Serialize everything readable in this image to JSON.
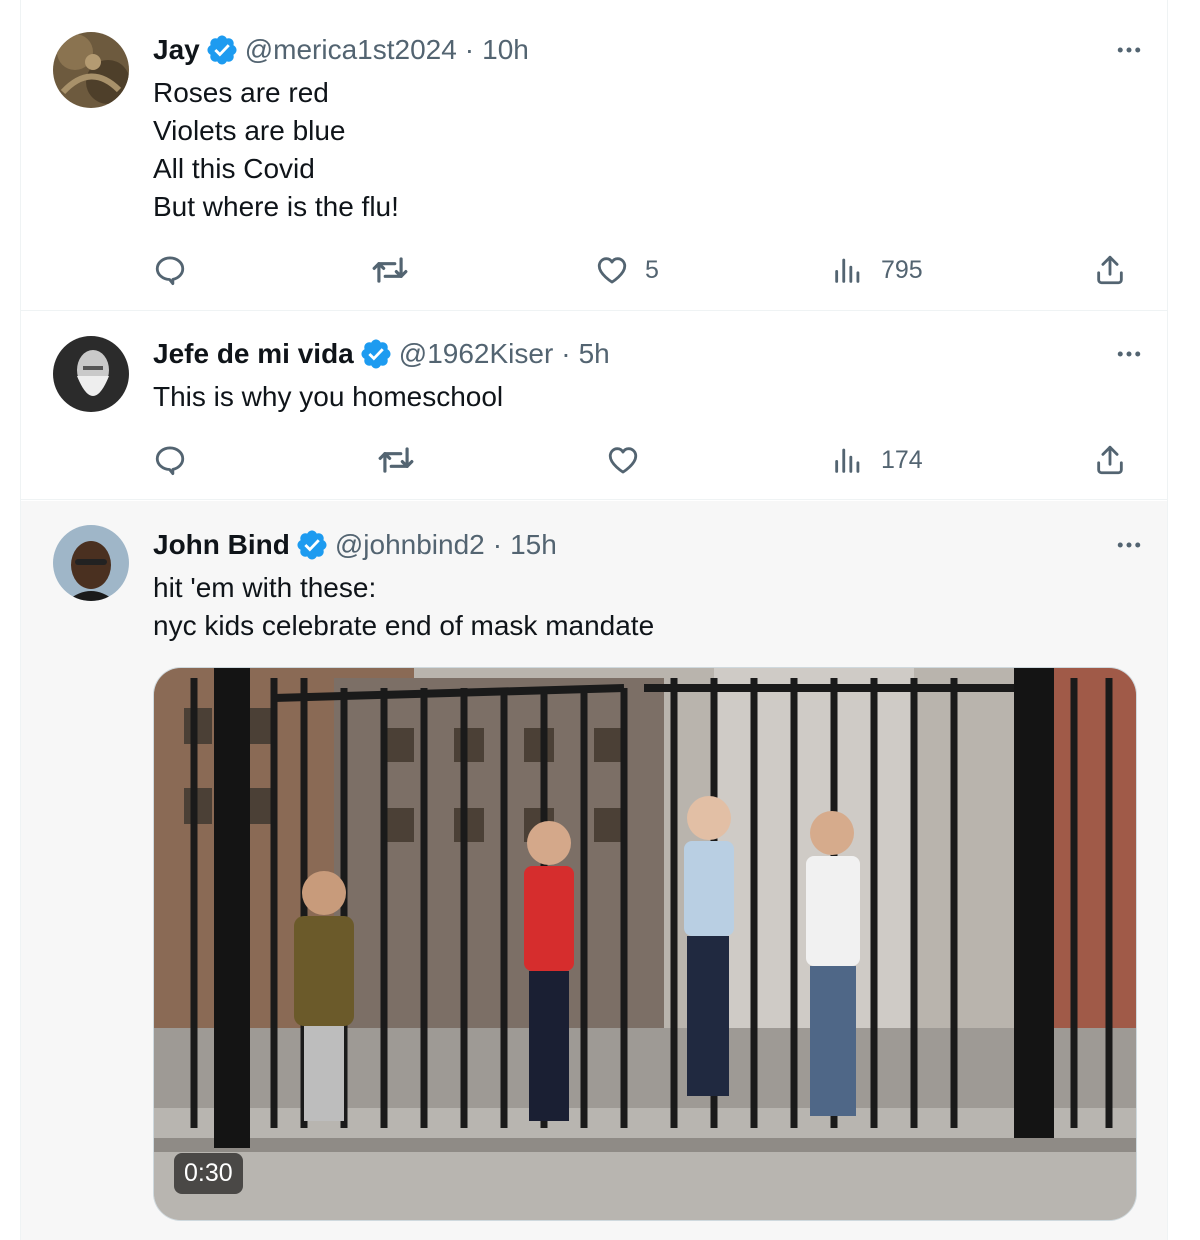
{
  "colors": {
    "accent": "#1d9bf0",
    "muted": "#536471",
    "text": "#0f1419"
  },
  "tweets": [
    {
      "name": "Jay",
      "handle": "@merica1st2024",
      "separator": "·",
      "time": "10h",
      "verified": true,
      "text_lines": [
        "Roses are red",
        "Violets are blue",
        "All this Covid",
        "But where is the flu!"
      ],
      "likes": "5",
      "views": "795"
    },
    {
      "name": "Jefe de mi vida",
      "handle": "@1962Kiser",
      "separator": "·",
      "time": "5h",
      "verified": true,
      "text_lines": [
        "This is why you homeschool"
      ],
      "views": "174"
    },
    {
      "name": "John Bind",
      "handle": "@johnbind2",
      "separator": "·",
      "time": "15h",
      "verified": true,
      "text_lines": [
        "hit 'em with these:",
        "nyc kids celebrate end of mask mandate"
      ],
      "video_duration": "0:30"
    }
  ],
  "icons": {
    "more": "more-horizontal-icon",
    "reply": "reply-icon",
    "retweet": "retweet-icon",
    "like": "heart-icon",
    "views": "views-icon",
    "share": "share-icon",
    "verified": "verified-badge-icon"
  }
}
